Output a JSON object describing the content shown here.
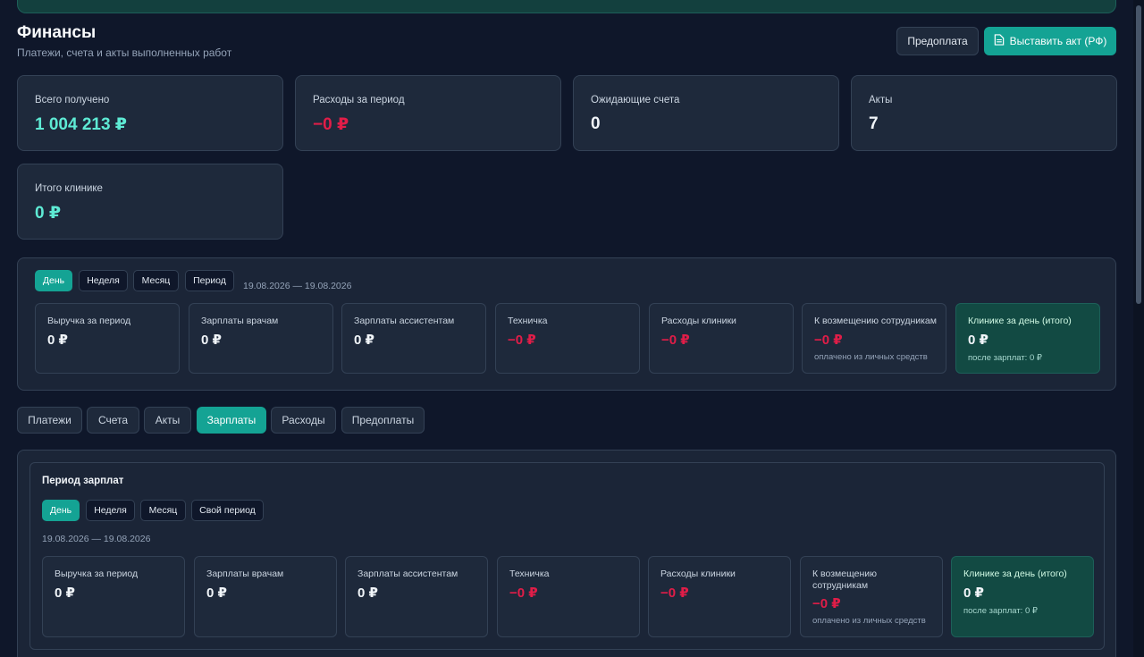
{
  "header": {
    "title": "Финансы",
    "subtitle": "Платежи, счета и акты выполненных работ",
    "prepay_button": "Предоплата",
    "act_button": "Выставить акт (РФ)",
    "act_icon": "document-icon"
  },
  "stats": [
    {
      "label": "Всего получено",
      "value": "1 004 213 ₽"
    },
    {
      "label": "Расходы за период",
      "value": "−0 ₽"
    },
    {
      "label": "Ожидающие счета",
      "value": "0"
    },
    {
      "label": "Акты",
      "value": "7"
    },
    {
      "label": "Итого клинике",
      "value": "0 ₽"
    }
  ],
  "period_panel": {
    "filters": [
      "День",
      "Неделя",
      "Месяц",
      "Период"
    ],
    "active_filter": "День",
    "date_range": "19.08.2026 — 19.08.2026",
    "cards": [
      {
        "label": "Выручка за период",
        "value": "0 ₽"
      },
      {
        "label": "Зарплаты врачам",
        "value": "0 ₽"
      },
      {
        "label": "Зарплаты ассистентам",
        "value": "0 ₽"
      },
      {
        "label": "Техничка",
        "value": "−0 ₽"
      },
      {
        "label": "Расходы клиники",
        "value": "−0 ₽"
      },
      {
        "label": "К возмещению сотрудникам",
        "value": "−0 ₽",
        "note": "оплачено из личных средств"
      },
      {
        "label": "Клинике за день (итого)",
        "value": "0 ₽",
        "note": "после зарплат: 0 ₽"
      }
    ]
  },
  "tabs": [
    "Платежи",
    "Счета",
    "Акты",
    "Зарплаты",
    "Расходы",
    "Предоплаты"
  ],
  "active_tab": "Зарплаты",
  "salary_section": {
    "title": "Период зарплат",
    "filters": [
      "День",
      "Неделя",
      "Месяц",
      "Свой период"
    ],
    "active_filter": "День",
    "date_range": "19.08.2026 — 19.08.2026",
    "cards": [
      {
        "label": "Выручка за период",
        "value": "0 ₽"
      },
      {
        "label": "Зарплаты врачам",
        "value": "0 ₽"
      },
      {
        "label": "Зарплаты ассистентам",
        "value": "0 ₽"
      },
      {
        "label": "Техничка",
        "value": "−0 ₽"
      },
      {
        "label": "Расходы клиники",
        "value": "−0 ₽"
      },
      {
        "label": "К возмещению сотрудникам",
        "value": "−0 ₽",
        "note": "оплачено из личных средств"
      },
      {
        "label": "Клинике за день (итого)",
        "value": "0 ₽",
        "note": "после зарплат: 0 ₽"
      }
    ]
  },
  "colors": {
    "background": "#0f172a",
    "card": "#1e293b",
    "accent": "#14a394",
    "positive": "#5eead4",
    "negative": "#e11d48"
  }
}
